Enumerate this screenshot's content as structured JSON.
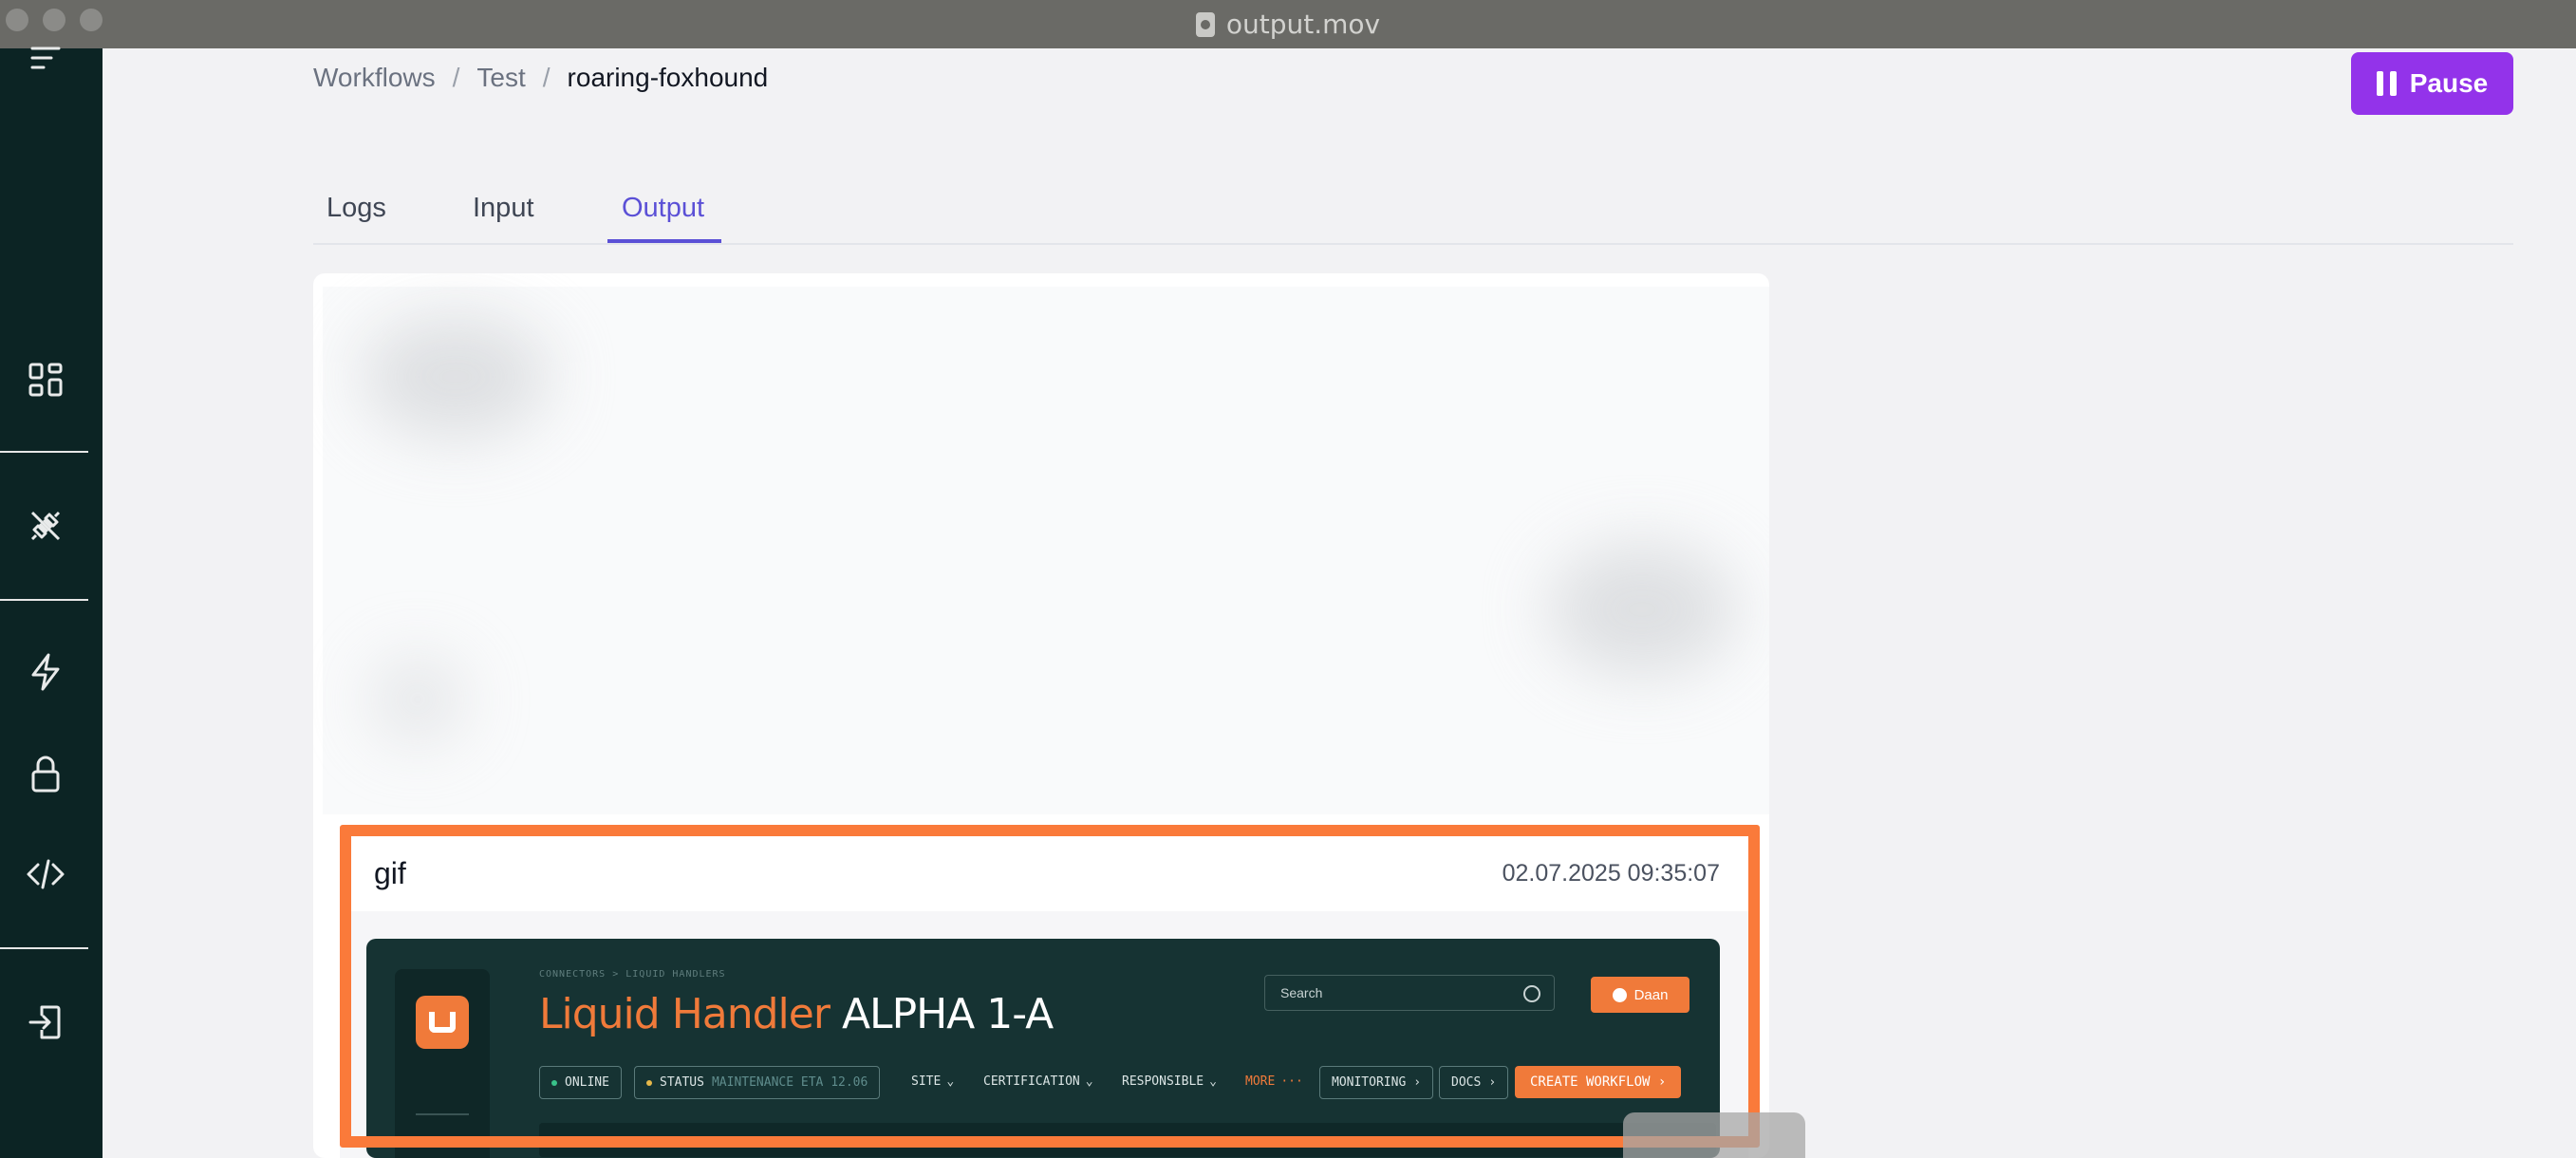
{
  "window": {
    "title": "output.mov"
  },
  "breadcrumb": {
    "items": [
      "Workflows",
      "Test"
    ],
    "separator": "/",
    "current": "roaring-foxhound"
  },
  "header": {
    "pause_label": "Pause",
    "accent_color": "#9333ea"
  },
  "tabs": [
    {
      "label": "Logs",
      "active": false
    },
    {
      "label": "Input",
      "active": false
    },
    {
      "label": "Output",
      "active": true
    }
  ],
  "sidebar": {
    "icons": [
      "menu-icon",
      "dashboard-icon",
      "plug-icon",
      "lightning-icon",
      "lock-icon",
      "code-icon",
      "logout-icon"
    ]
  },
  "output": {
    "item_title": "gif",
    "item_time": "02.07.2025 09:35:07",
    "highlight_color": "#fa7a3a"
  },
  "gif_frame": {
    "breadcrumb": "CONNECTORS > LIQUID HANDLERS",
    "title_highlight": "Liquid Handler",
    "title_rest": "ALPHA 1-A",
    "search_placeholder": "Search",
    "user_label": "Daan",
    "online_label": "ONLINE",
    "status_label": "STATUS",
    "status_value": "MAINTENANCE ETA 12.06",
    "menu_site": "SITE",
    "menu_certification": "CERTIFICATION",
    "menu_responsible": "RESPONSIBLE",
    "menu_more": "MORE",
    "monitoring_label": "MONITORING",
    "docs_label": "DOCS",
    "create_label": "CREATE WORKFLOW",
    "brand_color": "#f07a3a"
  }
}
